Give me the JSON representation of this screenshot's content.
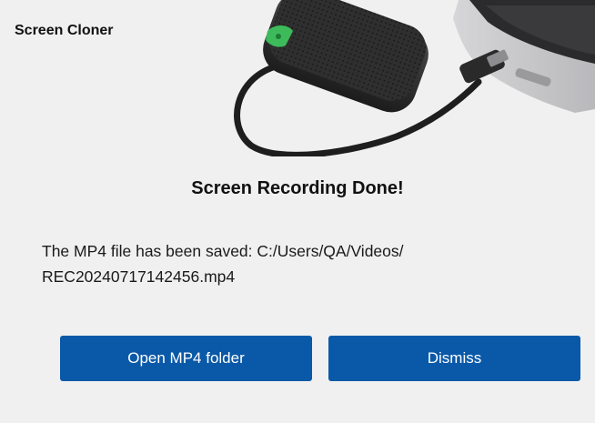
{
  "app": {
    "title": "Screen Cloner"
  },
  "dialog": {
    "headline": "Screen Recording Done!",
    "message_line1": "The MP4 file has been saved: C:/Users/QA/Videos/",
    "message_line2": "REC20240717142456.mp4"
  },
  "buttons": {
    "open_folder": "Open MP4 folder",
    "dismiss": "Dismiss"
  },
  "colors": {
    "background": "#f0f0f0",
    "button": "#0a59a8",
    "device_accent": "#3dbb5a"
  },
  "hero_image": {
    "icon": "screen-cloner-device-laptop-image"
  }
}
